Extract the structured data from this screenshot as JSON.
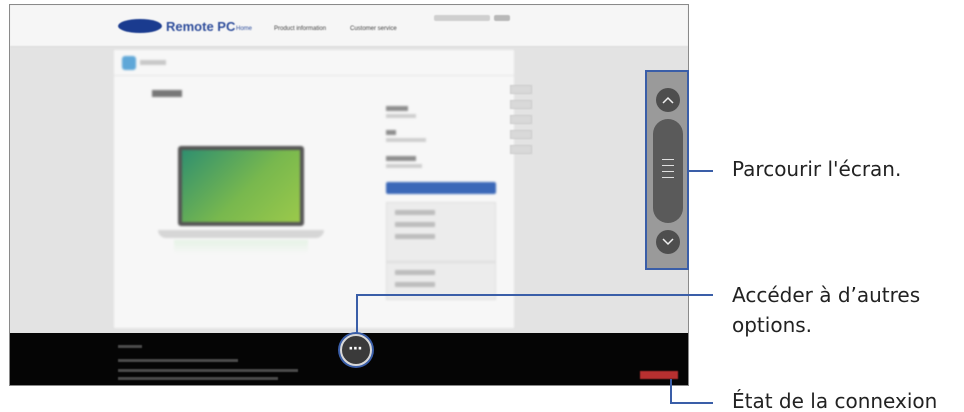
{
  "screenshot": {
    "site": {
      "logo_text": "Remote PC",
      "nav": [
        "Home",
        "Product information",
        "Customer service"
      ],
      "header_util_text": "",
      "page_title": "Home"
    },
    "scroll_control": {
      "up_icon": "chevron-up-icon",
      "down_icon": "chevron-down-icon",
      "grip_icon": "grip-lines-icon"
    },
    "more_button": {
      "label": "⋯",
      "icon": "more-options-icon"
    },
    "connection_status_color": "#b83030"
  },
  "callouts": {
    "scroll": "Parcourir l'écran.",
    "more_line1": "Accéder à d’autres",
    "more_line2": "options.",
    "status": "État de la connexion"
  },
  "colors": {
    "callout_line": "#3a5ea8",
    "footer_bg": "#050505",
    "accent_blue": "#3b68b8"
  }
}
